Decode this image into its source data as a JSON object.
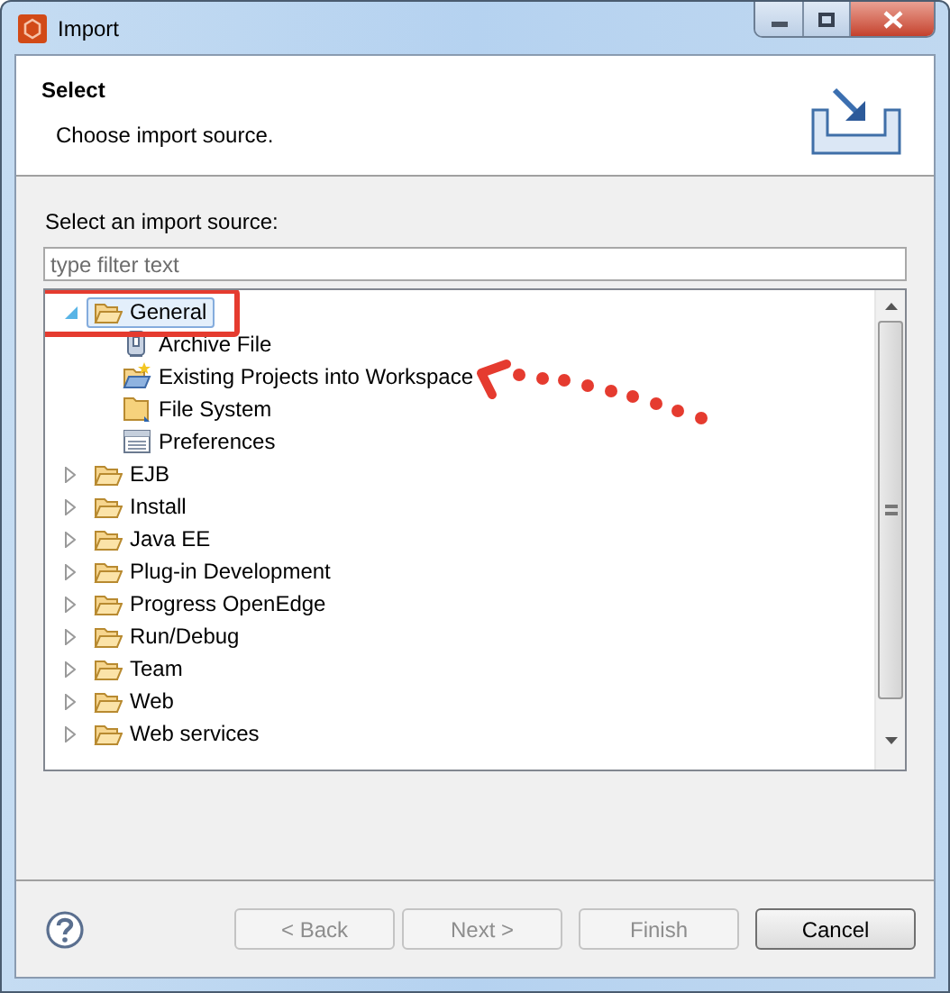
{
  "window": {
    "title": "Import"
  },
  "header": {
    "title": "Select",
    "description": "Choose import source."
  },
  "source_label": "Select an import source:",
  "filter": {
    "placeholder": "type filter text"
  },
  "tree": [
    {
      "label": "General",
      "expanded": true,
      "selected": true,
      "children": [
        {
          "label": "Archive File",
          "kind": "archive"
        },
        {
          "label": "Existing Projects into Workspace",
          "kind": "project"
        },
        {
          "label": "File System",
          "kind": "folder"
        },
        {
          "label": "Preferences",
          "kind": "prefs"
        }
      ]
    },
    {
      "label": "EJB",
      "expanded": false,
      "selected": false
    },
    {
      "label": "Install",
      "expanded": false,
      "selected": false
    },
    {
      "label": "Java EE",
      "expanded": false,
      "selected": false
    },
    {
      "label": "Plug-in Development",
      "expanded": false,
      "selected": false
    },
    {
      "label": "Progress OpenEdge",
      "expanded": false,
      "selected": false
    },
    {
      "label": "Run/Debug",
      "expanded": false,
      "selected": false
    },
    {
      "label": "Team",
      "expanded": false,
      "selected": false
    },
    {
      "label": "Web",
      "expanded": false,
      "selected": false
    },
    {
      "label": "Web services",
      "expanded": false,
      "selected": false
    }
  ],
  "buttons": [
    {
      "label": "< Back",
      "disabled": true
    },
    {
      "label": "Next >",
      "disabled": true
    },
    {
      "label": "Finish",
      "disabled": true
    },
    {
      "label": "Cancel",
      "disabled": false
    }
  ]
}
